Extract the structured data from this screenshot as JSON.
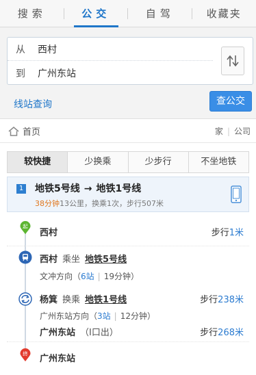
{
  "tabs": [
    {
      "label": "搜索"
    },
    {
      "label": "公交"
    },
    {
      "label": "自驾"
    },
    {
      "label": "收藏夹"
    }
  ],
  "route": {
    "from_label": "从",
    "from_value": "西村",
    "to_label": "到",
    "to_value": "广州东站",
    "station_query": "线站查询",
    "search_button": "查公交"
  },
  "crumbs": {
    "home": "首页",
    "home_short": "家",
    "company": "公司"
  },
  "filters": [
    {
      "label": "较快捷"
    },
    {
      "label": "少换乘"
    },
    {
      "label": "少步行"
    },
    {
      "label": "不坐地铁"
    }
  ],
  "plan": {
    "index": "1",
    "line_a": "地铁5号线",
    "arrow": "→",
    "line_b": "地铁1号线",
    "time": "38分钟",
    "summary": "13公里，换乘1次，步行507米"
  },
  "steps": {
    "start_badge": "起",
    "start_name": "西村",
    "start_walk_label": "步行",
    "start_walk_dist": "1米",
    "board_station": "西村",
    "board_verb": "乘坐",
    "board_line": "地铁5号线",
    "board_dir": "文冲方向（",
    "board_stops": "6站",
    "board_time": "19分钟",
    "board_close": "）",
    "transfer_station": "杨箕",
    "transfer_verb": "换乘",
    "transfer_line": "地铁1号线",
    "transfer_walk_label": "步行",
    "transfer_walk_dist": "238米",
    "transfer_dir": "广州东站方向（",
    "transfer_stops": "3站",
    "transfer_time": "12分钟",
    "transfer_close": "）",
    "exit_station": "广州东站",
    "exit_note": "（I口出）",
    "exit_walk_label": "步行",
    "exit_walk_dist": "268米",
    "end_badge": "终",
    "end_name": "广州东站"
  },
  "colors": {
    "accent": "#1f76c9",
    "start_green": "#5cb531",
    "end_red": "#e23b2e",
    "metro_blue": "#2d66b5",
    "time_orange": "#e0761d"
  }
}
